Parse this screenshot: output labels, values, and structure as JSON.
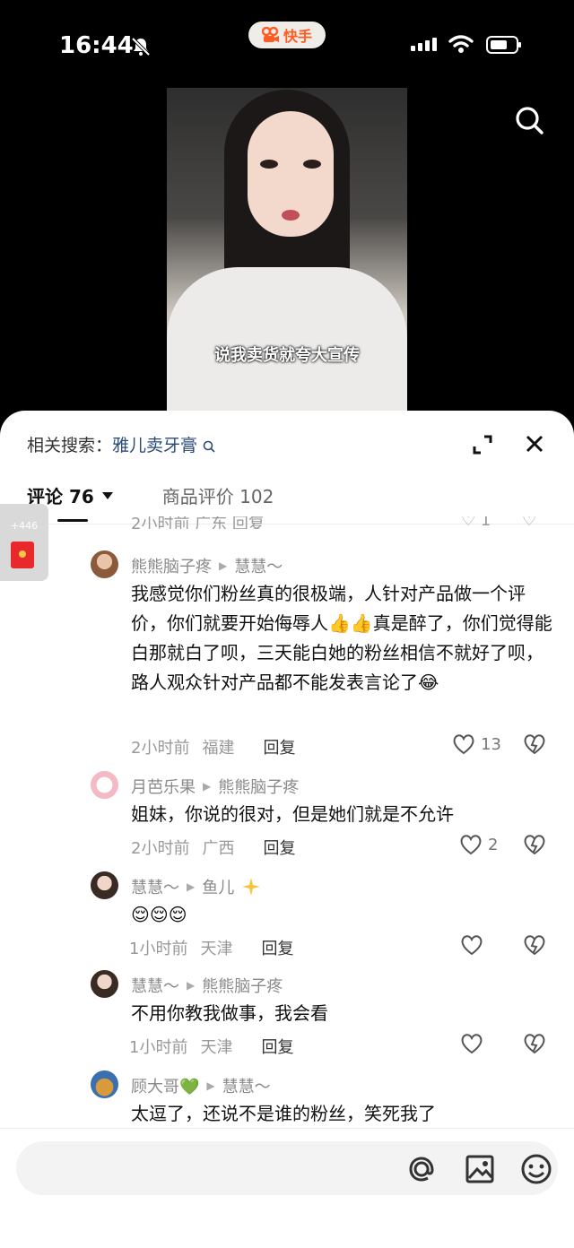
{
  "status": {
    "time": "16:44",
    "app_badge": "快手"
  },
  "video": {
    "subtitle": "说我卖货就夸大宣传"
  },
  "sheet": {
    "related_label": "相关搜索：",
    "related_keyword": "雅儿卖牙膏",
    "tab_comments": "评论 76",
    "tab_reviews": "商品评价 102"
  },
  "partial_row": {
    "meta": "2小时前 广东  回复",
    "likes": "1"
  },
  "red_packet": {
    "count": "+446"
  },
  "comments": [
    {
      "author": "熊熊脑子疼",
      "reply_to": "慧慧～",
      "text": "我感觉你们粉丝真的很极端，人针对产品做一个评价，你们就要开始侮辱人👍👍真是醉了，你们觉得能白那就白了呗，三天能白她的粉丝相信不就好了呗，路人观众针对产品都不能发表言论了😂",
      "time": "2小时前",
      "location": "福建",
      "reply": "回复",
      "likes": "13"
    },
    {
      "author": "月芭乐果",
      "reply_to": "熊熊脑子疼",
      "text": "姐妹，你说的很对，但是她们就是不允许",
      "time": "2小时前",
      "location": "广西",
      "reply": "回复",
      "likes": "2"
    },
    {
      "author": "慧慧～",
      "reply_to": "鱼儿",
      "text": "😌😌😌",
      "time": "1小时前",
      "location": "天津",
      "reply": "回复",
      "likes": ""
    },
    {
      "author": "慧慧～",
      "reply_to": "熊熊脑子疼",
      "text": "不用你教我做事，我会看",
      "time": "1小时前",
      "location": "天津",
      "reply": "回复",
      "likes": ""
    },
    {
      "author": "顾大哥💚",
      "reply_to": "慧慧～",
      "text": "太逗了，还说不是谁的粉丝，笑死我了",
      "time": "",
      "location": "",
      "reply": "",
      "likes": ""
    }
  ],
  "input": {
    "placeholder": ""
  },
  "icons": [
    "mute-bell-icon",
    "kuaishou-logo-icon",
    "signal-icon",
    "wifi-icon",
    "battery-icon",
    "search-icon",
    "expand-icon",
    "close-icon",
    "caret-down-icon",
    "heart-icon",
    "dislike-icon",
    "at-icon",
    "image-icon",
    "emoji-icon",
    "red-packet-icon"
  ],
  "colors": {
    "accent": "#ff5a1f",
    "keyword": "#2a4a7a",
    "red_packet": "#e8282b"
  }
}
